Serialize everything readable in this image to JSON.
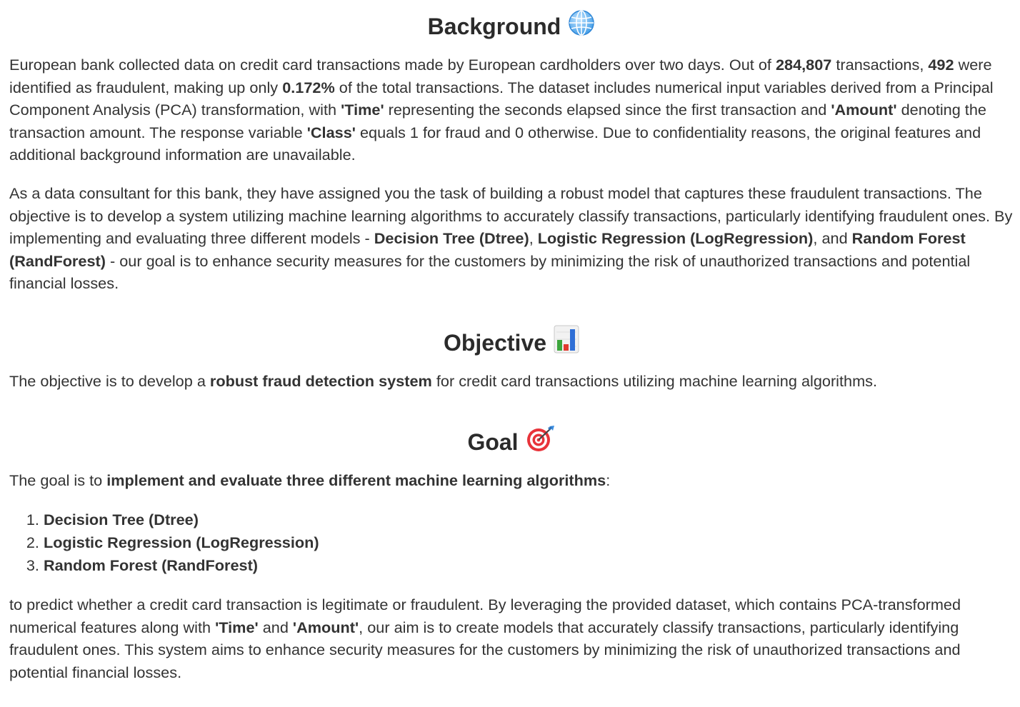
{
  "background": {
    "heading": "Background",
    "heading_icon": "globe-icon",
    "p1": {
      "t1": "European bank collected data on credit card transactions made by European cardholders over two days. Out of ",
      "b1": "284,807",
      "t2": " transactions, ",
      "b2": "492",
      "t3": " were identified as fraudulent, making up only ",
      "b3": "0.172%",
      "t4": " of the total transactions. The dataset includes numerical input variables derived from a Principal Component Analysis (PCA) transformation, with ",
      "b4": "'Time'",
      "t5": " representing the seconds elapsed since the first transaction and ",
      "b5": "'Amount'",
      "t6": " denoting the transaction amount. The response variable ",
      "b6": "'Class'",
      "t7": " equals 1 for fraud and 0 otherwise. Due to confidentiality reasons, the original features and additional background information are unavailable."
    },
    "p2": {
      "t1": "As a data consultant for this bank, they have assigned you the task of building a robust model that captures these fraudulent transactions. The objective is to develop a system utilizing machine learning algorithms to accurately classify transactions, particularly identifying fraudulent ones. By implementing and evaluating three different models - ",
      "b1": "Decision Tree (Dtree)",
      "t2": ", ",
      "b2": "Logistic Regression (LogRegression)",
      "t3": ", and ",
      "b3": "Random Forest (RandForest)",
      "t4": " - our goal is to enhance security measures for the customers by minimizing the risk of unauthorized transactions and potential financial losses."
    }
  },
  "objective": {
    "heading": "Objective",
    "heading_icon": "bar-chart-icon",
    "p": {
      "t1": "The objective is to develop a ",
      "b1": "robust fraud detection system",
      "t2": " for credit card transactions utilizing machine learning algorithms."
    }
  },
  "goal": {
    "heading": "Goal",
    "heading_icon": "target-dart-icon",
    "intro": {
      "t1": "The goal is to ",
      "b1": "implement and evaluate three different machine learning algorithms",
      "t2": ":"
    },
    "items": [
      "Decision Tree (Dtree)",
      "Logistic Regression (LogRegression)",
      "Random Forest (RandForest)"
    ],
    "outro": {
      "t1": "to predict whether a credit card transaction is legitimate or fraudulent. By leveraging the provided dataset, which contains PCA-transformed numerical features along with ",
      "b1": "'Time'",
      "t2": " and ",
      "b2": "'Amount'",
      "t3": ", our aim is to create models that accurately classify transactions, particularly identifying fraudulent ones. This system aims to enhance security measures for the customers by minimizing the risk of unauthorized transactions and potential financial losses."
    }
  }
}
